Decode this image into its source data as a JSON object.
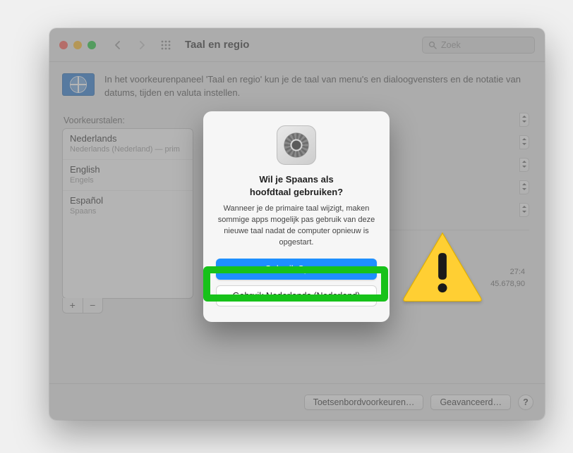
{
  "window": {
    "title": "Taal en regio",
    "search_placeholder": "Zoek"
  },
  "banner": {
    "text": "In het voorkeurenpaneel 'Taal en regio' kun je de taal van menu's en dialoogvensters en de notatie van datums, tijden en valuta instellen."
  },
  "left": {
    "label": "Voorkeurstalen:",
    "languages": [
      {
        "name": "Nederlands",
        "sub": "Nederlands (Nederland) — prim"
      },
      {
        "name": "English",
        "sub": "Engels"
      },
      {
        "name": "Español",
        "sub": "Spaans"
      }
    ]
  },
  "samples": {
    "time": "27:4",
    "number": "45.678,90"
  },
  "bottom": {
    "keyboard": "Toetsenbordvoorkeuren…",
    "advanced": "Geavanceerd…",
    "help": "?"
  },
  "dialog": {
    "heading_l1": "Wil je Spaans als",
    "heading_l2": "hoofdtaal gebruiken?",
    "body": "Wanneer je de primaire taal wijzigt, maken sommige apps mogelijk pas gebruik van deze nieuwe taal nadat de computer opnieuw is opgestart.",
    "primary": "Gebruik Spaans",
    "secondary": "Gebruik Nederlands (Nederland)"
  }
}
